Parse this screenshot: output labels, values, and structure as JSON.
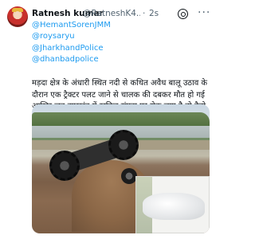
{
  "tweet": {
    "author_name": "Ratnesh kumar",
    "author_handle": "@RatneshK4...",
    "separator": "·",
    "timestamp": "2s",
    "mentions": [
      "@HemantSorenJMM",
      "@roysaryu",
      "@JharkhandPolice",
      "@dhanbadpolice"
    ],
    "text": "मड़दा क्षेत्र के अंधारी स्थित नदी से कथित अवैध बालू उठाव के दौरान एक ट्रैक्टर पलट जाने से चालक की दबकर मौत हो गई आखिर जब झारखंड में खनिज संपदा पर रोक लगा है तो कैसे खुलेआम बालू की अवैध तस्करी हो रही अपने स्तर ले संज्ञान ।"
  },
  "icons": {
    "avatar": "user-avatar",
    "circle": "grok-circle-icon",
    "more": "more-horizontal-icon"
  }
}
